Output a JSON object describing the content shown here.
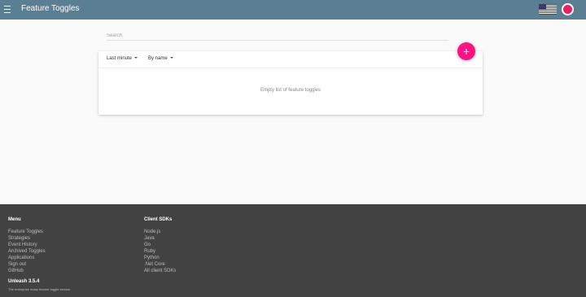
{
  "appbar": {
    "title": "Feature Toggles",
    "menu_icon": "hamburger-menu-icon",
    "flag_icon": "us-flag-icon",
    "avatar_icon": "user-avatar-icon"
  },
  "search": {
    "placeholder": "Search",
    "value": ""
  },
  "toolbar": {
    "time_filter": "Last minute",
    "sort": "By name",
    "add_icon": "plus-icon",
    "add_symbol": "+"
  },
  "list": {
    "empty_message": "Empty list of feature toggles"
  },
  "footer": {
    "menu_heading": "Menu",
    "menu_items": [
      "Feature Toggles",
      "Strategies",
      "Event History",
      "Archived Toggles",
      "Applications",
      "Sign out",
      "GitHub"
    ],
    "sdk_heading": "Client SDKs",
    "sdk_items": [
      "Node.js",
      "Java",
      "Go",
      "Ruby",
      "Python",
      ".Net Core",
      "All client SDKs"
    ],
    "version": "Unleash 3.5.4",
    "tagline": "The enterprise ready feature toggle service."
  },
  "colors": {
    "appbar": "#5b7f92",
    "accent": "#ff1283",
    "footer": "#424242"
  }
}
